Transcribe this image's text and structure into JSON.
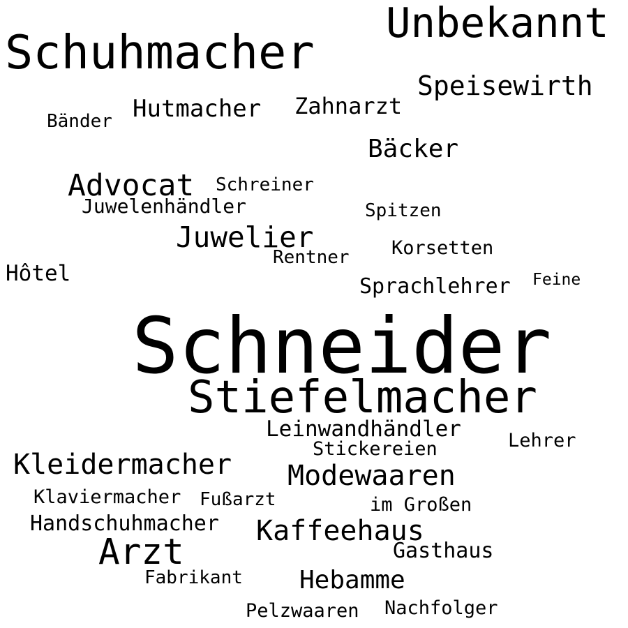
{
  "text_color": "#000000",
  "background_color": "#ffffff",
  "words": [
    {
      "key": "schneider",
      "text": "Schneider"
    },
    {
      "key": "stiefelmacher",
      "text": "Stiefelmacher"
    },
    {
      "key": "schuhmacher",
      "text": "Schuhmacher"
    },
    {
      "key": "unbekannt",
      "text": "Unbekannt"
    },
    {
      "key": "arzt",
      "text": "Arzt"
    },
    {
      "key": "advocat",
      "text": "Advocat"
    },
    {
      "key": "kleidermacher",
      "text": "Kleidermacher"
    },
    {
      "key": "juwelier",
      "text": "Juwelier"
    },
    {
      "key": "modewaaren",
      "text": "Modewaaren"
    },
    {
      "key": "kaffeehaus",
      "text": "Kaffeehaus"
    },
    {
      "key": "speisewirth",
      "text": "Speisewirth"
    },
    {
      "key": "baecker",
      "text": "Bäcker"
    },
    {
      "key": "hutmacher",
      "text": "Hutmacher"
    },
    {
      "key": "hebamme",
      "text": "Hebamme"
    },
    {
      "key": "zahnarzt",
      "text": "Zahnarzt"
    },
    {
      "key": "leinwandhaendler",
      "text": "Leinwandhändler"
    },
    {
      "key": "handschuhmacher",
      "text": "Handschuhmacher"
    },
    {
      "key": "gasthaus",
      "text": "Gasthaus"
    },
    {
      "key": "sprachlehrer",
      "text": "Sprachlehrer"
    },
    {
      "key": "hotel",
      "text": "Hôtel"
    },
    {
      "key": "juwelenhaendler",
      "text": "Juwelenhändler"
    },
    {
      "key": "klaviermacher",
      "text": "Klaviermacher"
    },
    {
      "key": "stickereien",
      "text": "Stickereien"
    },
    {
      "key": "korsetten",
      "text": "Korsetten"
    },
    {
      "key": "lehrer",
      "text": "Lehrer"
    },
    {
      "key": "im-grossen",
      "text": "im Großen"
    },
    {
      "key": "pelzwaaren",
      "text": "Pelzwaaren"
    },
    {
      "key": "nachfolger",
      "text": "Nachfolger"
    },
    {
      "key": "schreiner",
      "text": "Schreiner"
    },
    {
      "key": "rentner",
      "text": "Rentner"
    },
    {
      "key": "fabrikant",
      "text": "Fabrikant"
    },
    {
      "key": "spitzen",
      "text": "Spitzen"
    },
    {
      "key": "fussarzt",
      "text": "Fußarzt"
    },
    {
      "key": "baender",
      "text": "Bänder"
    },
    {
      "key": "feine",
      "text": "Feine"
    }
  ]
}
